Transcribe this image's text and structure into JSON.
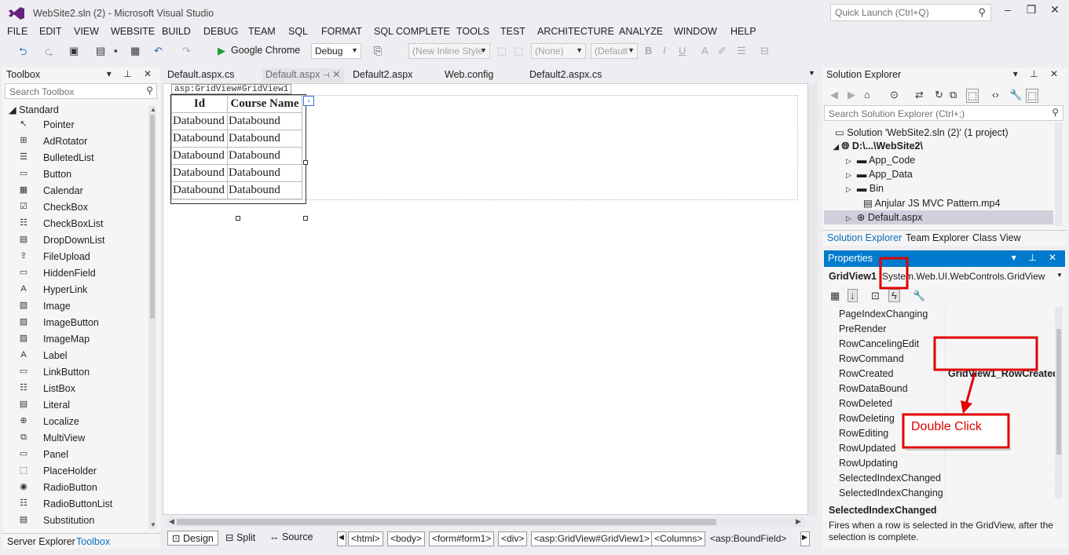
{
  "window": {
    "title": "WebSite2.sln (2) - Microsoft Visual Studio",
    "quick_launch": "Quick Launch (Ctrl+Q)"
  },
  "menu": [
    "FILE",
    "EDIT",
    "VIEW",
    "WEBSITE",
    "BUILD",
    "DEBUG",
    "TEAM",
    "SQL",
    "FORMAT",
    "SQL COMPLETE",
    "TOOLS",
    "TEST",
    "ARCHITECTURE",
    "ANALYZE",
    "WINDOW",
    "HELP"
  ],
  "toolbar": {
    "browser": "Google Chrome",
    "config": "Debug",
    "style": "(New Inline Style",
    "target": "(None)",
    "font": "(Default",
    "bold": "B",
    "italic": "I",
    "underline": "U"
  },
  "toolbox": {
    "title": "Toolbox",
    "search": "Search Toolbox",
    "category": "Standard",
    "items": [
      {
        "label": "Pointer",
        "icon": "pointer-icon"
      },
      {
        "label": "AdRotator",
        "icon": "adrotator-icon"
      },
      {
        "label": "BulletedList",
        "icon": "bulletedlist-icon"
      },
      {
        "label": "Button",
        "icon": "button-icon"
      },
      {
        "label": "Calendar",
        "icon": "calendar-icon"
      },
      {
        "label": "CheckBox",
        "icon": "checkbox-icon"
      },
      {
        "label": "CheckBoxList",
        "icon": "checkboxlist-icon"
      },
      {
        "label": "DropDownList",
        "icon": "dropdownlist-icon"
      },
      {
        "label": "FileUpload",
        "icon": "fileupload-icon"
      },
      {
        "label": "HiddenField",
        "icon": "hiddenfield-icon"
      },
      {
        "label": "HyperLink",
        "icon": "hyperlink-icon"
      },
      {
        "label": "Image",
        "icon": "image-icon"
      },
      {
        "label": "ImageButton",
        "icon": "imagebutton-icon"
      },
      {
        "label": "ImageMap",
        "icon": "imagemap-icon"
      },
      {
        "label": "Label",
        "icon": "label-icon"
      },
      {
        "label": "LinkButton",
        "icon": "linkbutton-icon"
      },
      {
        "label": "ListBox",
        "icon": "listbox-icon"
      },
      {
        "label": "Literal",
        "icon": "literal-icon"
      },
      {
        "label": "Localize",
        "icon": "localize-icon"
      },
      {
        "label": "MultiView",
        "icon": "multiview-icon"
      },
      {
        "label": "Panel",
        "icon": "panel-icon"
      },
      {
        "label": "PlaceHolder",
        "icon": "placeholder-icon"
      },
      {
        "label": "RadioButton",
        "icon": "radiobutton-icon"
      },
      {
        "label": "RadioButtonList",
        "icon": "radiobuttonlist-icon"
      },
      {
        "label": "Substitution",
        "icon": "substitution-icon"
      }
    ],
    "tabs": [
      "Server Explorer",
      "Toolbox"
    ]
  },
  "editor": {
    "tabs": [
      "Default.aspx.cs",
      "Default.aspx",
      "Default2.aspx",
      "Web.config",
      "Default2.aspx.cs"
    ],
    "tag": "asp:GridView#GridView1",
    "grid": {
      "headers": [
        "Id",
        "Course Name"
      ],
      "rows": [
        [
          "Databound",
          "Databound"
        ],
        [
          "Databound",
          "Databound"
        ],
        [
          "Databound",
          "Databound"
        ],
        [
          "Databound",
          "Databound"
        ],
        [
          "Databound",
          "Databound"
        ]
      ]
    },
    "views": [
      "Design",
      "Split",
      "Source"
    ],
    "breadcrumbs": [
      "<html>",
      "<body>",
      "<form#form1>",
      "<div>",
      "<asp:GridView#GridView1>",
      "<Columns>",
      "<asp:BoundField>"
    ]
  },
  "solution_explorer": {
    "title": "Solution Explorer",
    "search": "Search Solution Explorer (Ctrl+;)",
    "solution": "Solution 'WebSite2.sln (2)' (1 project)",
    "project": "D:\\...\\WebSite2\\",
    "nodes": [
      "App_Code",
      "App_Data",
      "Bin",
      "Anjular JS MVC Pattern.mp4",
      "Default.aspx"
    ],
    "tabs": [
      "Solution Explorer",
      "Team Explorer",
      "Class View"
    ]
  },
  "properties": {
    "title": "Properties",
    "object": "GridView1",
    "type": "System.Web.UI.WebControls.GridView",
    "events": [
      {
        "name": "PageIndexChanging",
        "value": ""
      },
      {
        "name": "PreRender",
        "value": ""
      },
      {
        "name": "RowCancelingEdit",
        "value": ""
      },
      {
        "name": "RowCommand",
        "value": ""
      },
      {
        "name": "RowCreated",
        "value": "GridView1_RowCreated"
      },
      {
        "name": "RowDataBound",
        "value": ""
      },
      {
        "name": "RowDeleted",
        "value": ""
      },
      {
        "name": "RowDeleting",
        "value": ""
      },
      {
        "name": "RowEditing",
        "value": ""
      },
      {
        "name": "RowUpdated",
        "value": ""
      },
      {
        "name": "RowUpdating",
        "value": ""
      },
      {
        "name": "SelectedIndexChanged",
        "value": ""
      },
      {
        "name": "SelectedIndexChanging",
        "value": ""
      }
    ],
    "desc_title": "SelectedIndexChanged",
    "desc_text": "Fires when a row is selected in the GridView, after the selection is complete."
  },
  "annotation": {
    "text": "Double Click",
    "color": "#e00000"
  },
  "colors": {
    "accent": "#007acc",
    "annotation": "#e00000"
  }
}
